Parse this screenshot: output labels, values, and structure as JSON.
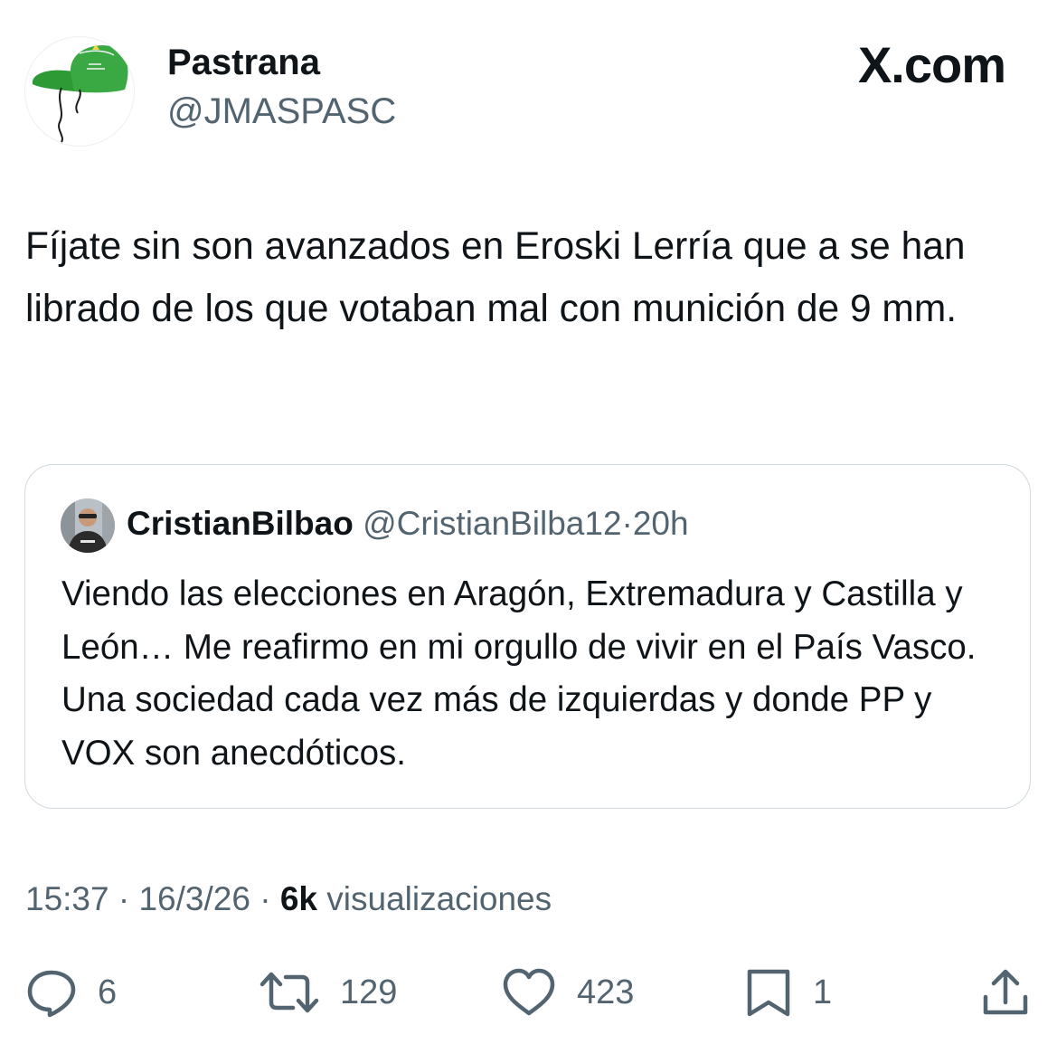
{
  "author": {
    "display_name": "Pastrana",
    "handle": "@JMASPASC",
    "avatar_icon": "green-cap-avatar"
  },
  "site_label": "X.com",
  "tweet": {
    "text": "Fíjate sin son avanzados en Eroski Lerría que a se han librado de los que votaban mal con munición de 9 mm."
  },
  "quoted_tweet": {
    "display_name": "CristianBilbao",
    "handle": "@CristianBilba12",
    "separator": "·",
    "time": "20h",
    "avatar_icon": "person-photo-avatar",
    "text": "Viendo las elecciones en Aragón, Extremadura y Castilla y León… Me reafirmo en mi orgullo de vivir en el País Vasco. Una sociedad cada vez más de izquierdas y donde PP y VOX son anecdóticos."
  },
  "meta": {
    "time": "15:37",
    "separator": "·",
    "date": "16/3/26",
    "views_count": "6k",
    "views_label": "visualizaciones"
  },
  "actions": {
    "replies": "6",
    "retweets": "129",
    "likes": "423",
    "bookmarks": "1"
  },
  "icons": {
    "reply": "reply-icon",
    "retweet": "retweet-icon",
    "like": "heart-icon",
    "bookmark": "bookmark-icon",
    "share": "share-icon"
  },
  "colors": {
    "text_primary": "#0f1419",
    "text_secondary": "#536471",
    "border": "#cfd9de",
    "cap_green": "#2e9a36"
  }
}
